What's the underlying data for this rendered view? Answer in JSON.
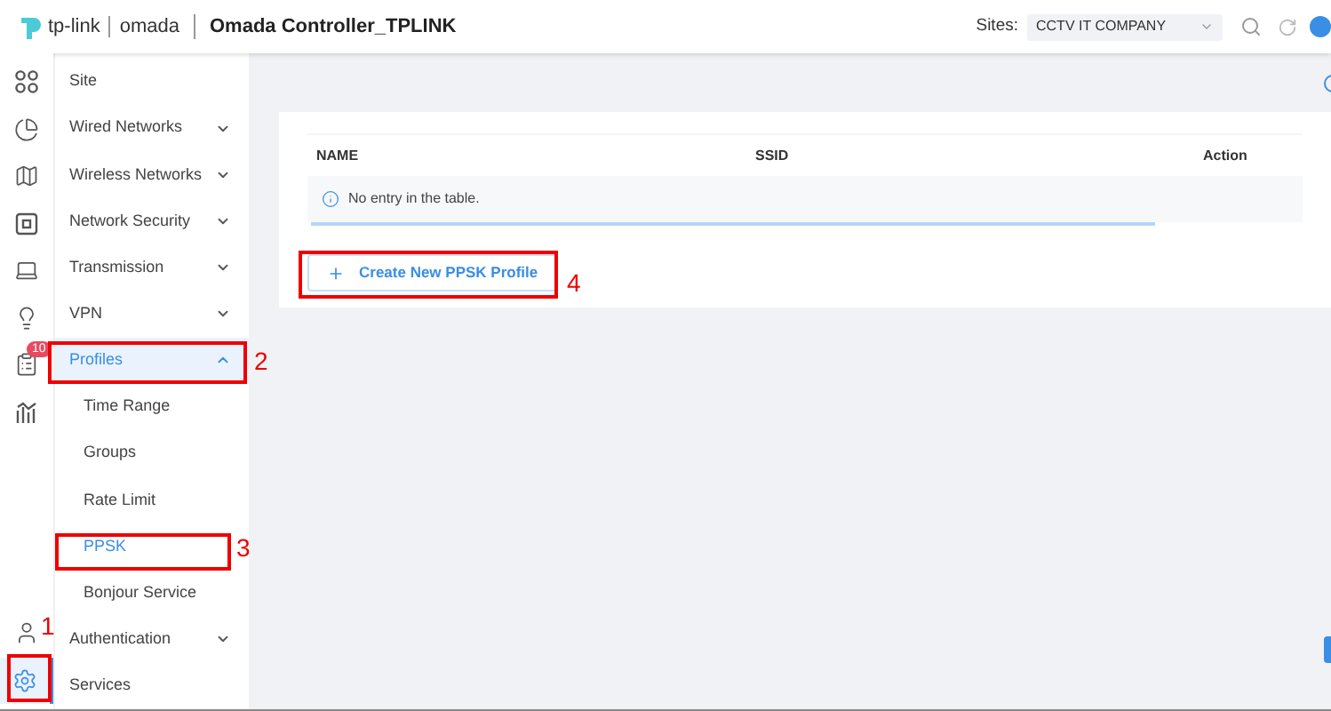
{
  "header": {
    "brand": "tp-link",
    "product": "omada",
    "title": "Omada Controller_TPLINK",
    "sites_label": "Sites:",
    "site_value": "CCTV IT COMPANY"
  },
  "rail": [
    {
      "kind": "grid",
      "selected": false
    },
    {
      "kind": "chart",
      "selected": false
    },
    {
      "kind": "map",
      "selected": false
    },
    {
      "kind": "device",
      "selected": false
    },
    {
      "kind": "monitor",
      "selected": false
    },
    {
      "kind": "bulb",
      "selected": false
    },
    {
      "kind": "inbox",
      "selected": false,
      "badge": "10"
    },
    {
      "kind": "stats",
      "selected": false
    },
    {
      "kind": "user",
      "selected": false
    },
    {
      "kind": "gear",
      "selected": true,
      "annotation": "1"
    }
  ],
  "menu": [
    {
      "label": "Site",
      "selected": false
    },
    {
      "label": "Wired Networks",
      "expanded": false,
      "selected": false
    },
    {
      "label": "Wireless Networks",
      "expanded": false,
      "selected": false
    },
    {
      "label": "Network Security",
      "expanded": false,
      "selected": false
    },
    {
      "label": "Transmission",
      "expanded": false,
      "selected": false
    },
    {
      "label": "VPN",
      "expanded": false,
      "selected": false
    },
    {
      "label": "Profiles",
      "expanded": true,
      "selected": true,
      "annotation": "2",
      "children": [
        {
          "label": "Time Range",
          "selected": false
        },
        {
          "label": "Groups",
          "selected": false
        },
        {
          "label": "Rate Limit",
          "selected": false
        },
        {
          "label": "PPSK",
          "selected": true,
          "annotation": "3"
        },
        {
          "label": "Bonjour Service",
          "selected": false
        }
      ]
    },
    {
      "label": "Authentication",
      "expanded": false,
      "selected": false
    },
    {
      "label": "Services",
      "selected": false
    }
  ],
  "table": {
    "columns": [
      "NAME",
      "SSID",
      "Action"
    ],
    "empty_text": "No entry in the table."
  },
  "create_button": {
    "label": "Create New PPSK Profile",
    "annotation": "4"
  }
}
